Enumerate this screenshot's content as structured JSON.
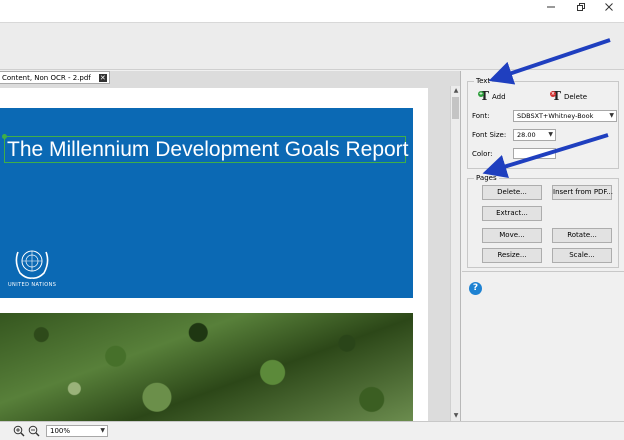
{
  "window": {
    "minimize_icon": "minimize-icon",
    "restore_icon": "restore-icon",
    "close_icon": "close-icon"
  },
  "document_tab": {
    "label": "Content, Non OCR - 2.pdf",
    "close_glyph": "✕"
  },
  "page": {
    "title": "The Millennium Development Goals Report",
    "emblem_caption": "UNITED NATIONS",
    "band_color": "#0b69b4"
  },
  "text_group": {
    "title": "Text",
    "add_label": "Add",
    "delete_label": "Delete",
    "font_label": "Font:",
    "font_value": "SDBSXT+Whitney-Book",
    "font_size_label": "Font Size:",
    "font_size_value": "28.00",
    "color_label": "Color:"
  },
  "pages_group": {
    "title": "Pages",
    "delete_label": "Delete...",
    "insert_label": "Insert from PDF...",
    "extract_label": "Extract...",
    "move_label": "Move...",
    "rotate_label": "Rotate...",
    "resize_label": "Resize...",
    "scale_label": "Scale..."
  },
  "help": {
    "glyph": "?"
  },
  "statusbar": {
    "zoom_value": "100%"
  },
  "colors": {
    "annotation_arrow": "#1f3fbf",
    "help": "#1e82d2"
  }
}
